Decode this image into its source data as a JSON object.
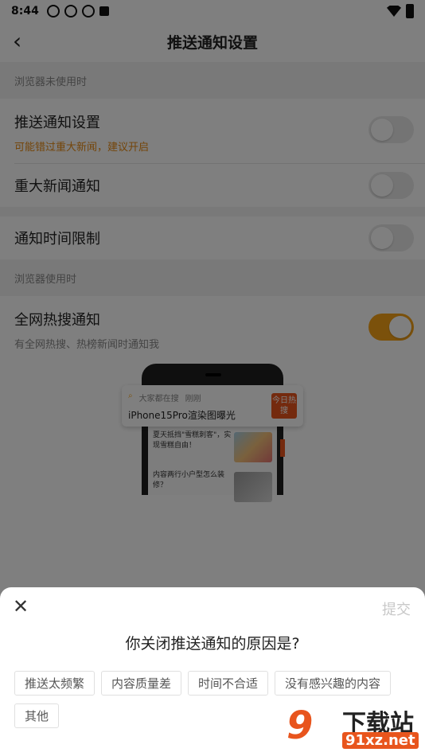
{
  "status_bar": {
    "time": "8:44"
  },
  "header": {
    "title": "推送通知设置"
  },
  "sections": [
    {
      "heading": "浏览器未使用时"
    },
    {
      "heading": "浏览器使用时"
    }
  ],
  "rows": {
    "push_settings": {
      "label": "推送通知设置",
      "sub": "可能错过重大新闻，建议开启",
      "toggle_on": false
    },
    "major_news": {
      "label": "重大新闻通知",
      "toggle_on": false
    },
    "time_limit": {
      "label": "通知时间限制",
      "toggle_on": false
    },
    "hot_search": {
      "label": "全网热搜通知",
      "sub": "有全网热搜、热榜新闻时通知我",
      "toggle_on": true
    }
  },
  "illustration": {
    "card_source": "大家都在搜",
    "card_time": "刚刚",
    "card_headline": "iPhone15Pro渲染图曝光",
    "card_badge": "今日热搜",
    "item1": "夏天抵挡\"雪糕刺客\"，实现雪糕自由！",
    "item2": "内容两行小户型怎么装修？"
  },
  "sheet": {
    "submit_label": "提交",
    "question": "你关闭推送通知的原因是?",
    "options": [
      "推送太频繁",
      "内容质量差",
      "时间不合适",
      "没有感兴趣的内容",
      "其他"
    ]
  },
  "watermark": {
    "logo": "9",
    "text": "下载站",
    "url": "91xz.net"
  },
  "colors": {
    "accent": "#f7a317",
    "warning": "#e88a12",
    "badge": "#e8551d"
  }
}
